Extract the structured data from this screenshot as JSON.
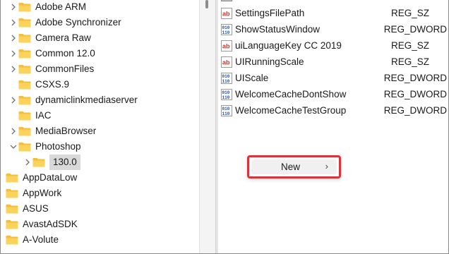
{
  "tree": {
    "items": [
      {
        "label": "Adobe ARM",
        "expander": "collapsed"
      },
      {
        "label": "Adobe Synchronizer",
        "expander": "collapsed"
      },
      {
        "label": "Camera Raw",
        "expander": "collapsed"
      },
      {
        "label": "Common 12.0",
        "expander": "collapsed"
      },
      {
        "label": "CommonFiles",
        "expander": "collapsed"
      },
      {
        "label": "CSXS.9",
        "expander": "none"
      },
      {
        "label": "dynamiclinkmediaserver",
        "expander": "collapsed"
      },
      {
        "label": "IAC",
        "expander": "none"
      },
      {
        "label": "MediaBrowser",
        "expander": "collapsed"
      },
      {
        "label": "Photoshop",
        "expander": "expanded"
      },
      {
        "label": "130.0",
        "expander": "collapsed",
        "selected": true
      },
      {
        "label": "AppDataLow",
        "expander": "none"
      },
      {
        "label": "AppWork",
        "expander": "none"
      },
      {
        "label": "ASUS",
        "expander": "none"
      },
      {
        "label": "AvastAdSDK",
        "expander": "none"
      },
      {
        "label": "A-Volute",
        "expander": "none"
      }
    ]
  },
  "values": {
    "rows": [
      {
        "name": "SettingsFilePath",
        "type": "REG_SZ",
        "icon": "string-value-icon"
      },
      {
        "name": "ShowStatusWindow",
        "type": "REG_DWORD",
        "icon": "dword-value-icon"
      },
      {
        "name": "uiLanguageKey CC 2019",
        "type": "REG_SZ",
        "icon": "string-value-icon"
      },
      {
        "name": "UIRunningScale",
        "type": "REG_SZ",
        "icon": "string-value-icon"
      },
      {
        "name": "UIScale",
        "type": "REG_DWORD",
        "icon": "dword-value-icon"
      },
      {
        "name": "WelcomeCacheDontShow",
        "type": "REG_DWORD",
        "icon": "dword-value-icon"
      },
      {
        "name": "WelcomeCacheTestGroup",
        "type": "REG_DWORD",
        "icon": "dword-value-icon"
      }
    ]
  },
  "context_menu": {
    "new_label": "New",
    "submenu_arrow": "›"
  },
  "colors": {
    "folder_yellow": "#f6c84c",
    "highlight_red": "#d9343b",
    "selected_bg": "#d9d9d9"
  }
}
